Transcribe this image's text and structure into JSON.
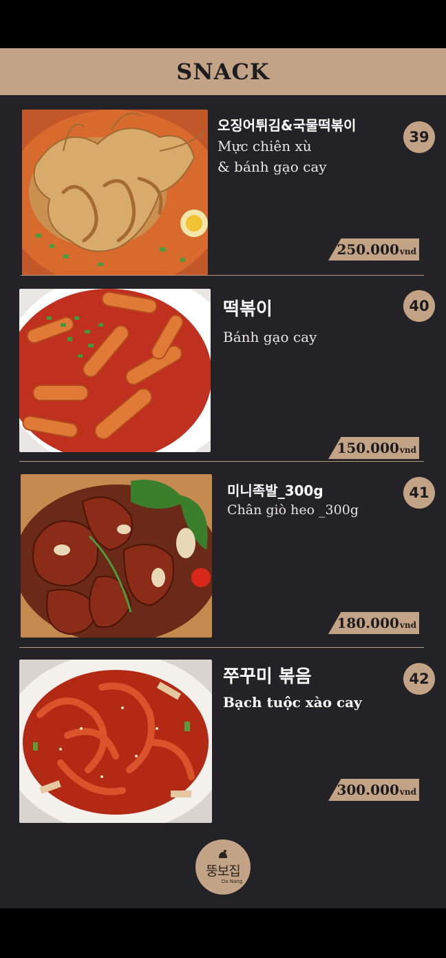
{
  "header": {
    "title": "SNACK"
  },
  "items": [
    {
      "name_ko": "오징어튀김&국물떡볶이",
      "name_vi": "Mực chiên xù\n& bánh gạo cay",
      "number": "39",
      "price": "250.000",
      "unit": "vnd"
    },
    {
      "name_ko": "떡볶이",
      "name_vi": "Bánh gạo cay",
      "number": "40",
      "price": "150.000",
      "unit": "vnd"
    },
    {
      "name_ko": "미니족발_300g",
      "name_vi": "Chân giò heo _300g",
      "number": "41",
      "price": "180.000",
      "unit": "vnd"
    },
    {
      "name_ko": "쭈꾸미 볶음",
      "name_vi": "Bạch tuộc xào cay",
      "number": "42",
      "price": "300.000",
      "unit": "vnd"
    }
  ],
  "logo": {
    "name": "뚱보집",
    "sub": "Da Nang"
  },
  "colors": {
    "background": "#232226",
    "accent": "#c3a386",
    "text": "#ffffff"
  }
}
